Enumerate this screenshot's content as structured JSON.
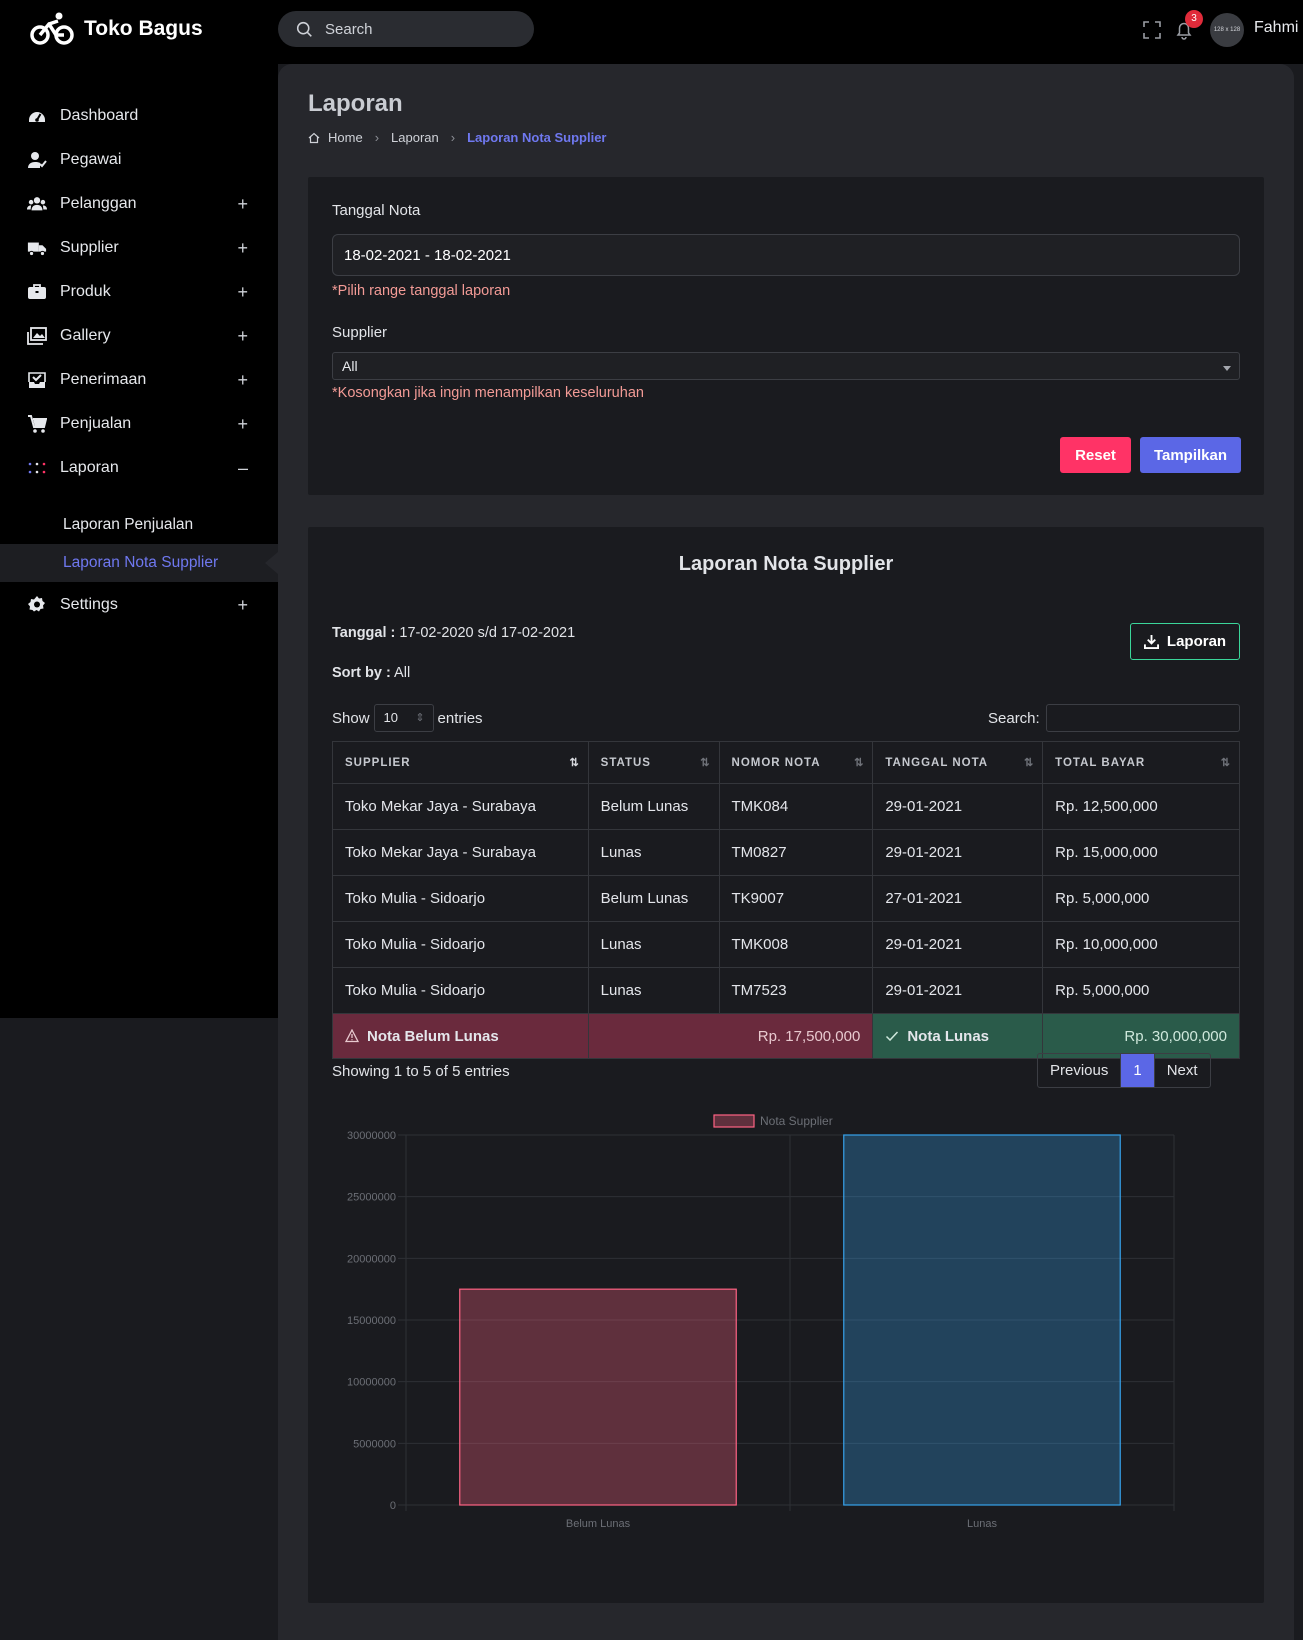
{
  "header": {
    "app_name": "Toko Bagus",
    "search_placeholder": "Search",
    "notification_count": "3",
    "avatar_text": "128 x 128",
    "username": "Fahmi"
  },
  "sidebar": {
    "items": [
      {
        "label": "Dashboard",
        "icon": "dashboard-icon"
      },
      {
        "label": "Pegawai",
        "icon": "user-check-icon"
      },
      {
        "label": "Pelanggan",
        "icon": "users-icon",
        "toggle": "+"
      },
      {
        "label": "Supplier",
        "icon": "truck-icon",
        "toggle": "+"
      },
      {
        "label": "Produk",
        "icon": "briefcase-icon",
        "toggle": "+"
      },
      {
        "label": "Gallery",
        "icon": "images-icon",
        "toggle": "+"
      },
      {
        "label": "Penerimaan",
        "icon": "inbox-check-icon",
        "toggle": "+"
      },
      {
        "label": "Penjualan",
        "icon": "cart-icon",
        "toggle": "+"
      },
      {
        "label": "Laporan",
        "icon": "grid-dots-icon",
        "toggle": "–"
      },
      {
        "label": "Settings",
        "icon": "gear-icon",
        "toggle": "+"
      }
    ],
    "laporan_children": [
      "Laporan Penjualan",
      "Laporan Nota Supplier"
    ]
  },
  "page": {
    "title": "Laporan",
    "breadcrumb": [
      "Home",
      "Laporan",
      "Laporan Nota Supplier"
    ]
  },
  "filter": {
    "date_label": "Tanggal Nota",
    "date_value": "18-02-2021 - 18-02-2021",
    "date_hint": "*Pilih range tanggal laporan",
    "supplier_label": "Supplier",
    "supplier_value": "All",
    "supplier_hint": "*Kosongkan jika ingin menampilkan keseluruhan",
    "reset_label": "Reset",
    "submit_label": "Tampilkan"
  },
  "report": {
    "title": "Laporan Nota Supplier",
    "tanggal_label": "Tanggal :",
    "tanggal_value": "17-02-2020 s/d 17-02-2021",
    "sort_label": "Sort by :",
    "sort_value": "All",
    "download_label": "Laporan",
    "show_label": "Show",
    "show_value": "10",
    "entries_label": "entries",
    "search_label": "Search:",
    "columns": [
      "SUPPLIER",
      "STATUS",
      "NOMOR NOTA",
      "TANGGAL NOTA",
      "TOTAL BAYAR"
    ],
    "rows": [
      [
        "Toko Mekar Jaya - Surabaya",
        "Belum Lunas",
        "TMK084",
        "29-01-2021",
        "Rp. 12,500,000"
      ],
      [
        "Toko Mekar Jaya - Surabaya",
        "Lunas",
        "TM0827",
        "29-01-2021",
        "Rp. 15,000,000"
      ],
      [
        "Toko Mulia - Sidoarjo",
        "Belum Lunas",
        "TK9007",
        "27-01-2021",
        "Rp. 5,000,000"
      ],
      [
        "Toko Mulia - Sidoarjo",
        "Lunas",
        "TMK008",
        "29-01-2021",
        "Rp. 10,000,000"
      ],
      [
        "Toko Mulia - Sidoarjo",
        "Lunas",
        "TM7523",
        "29-01-2021",
        "Rp. 5,000,000"
      ]
    ],
    "footer": {
      "unpaid_label": "Nota Belum Lunas",
      "unpaid_total": "Rp. 17,500,000",
      "paid_label": "Nota Lunas",
      "paid_total": "Rp. 30,000,000"
    },
    "showing_text": "Showing 1 to 5 of 5 entries",
    "pager": {
      "prev": "Previous",
      "page": "1",
      "next": "Next"
    }
  },
  "colors": {
    "accent": "#5b67e6",
    "reset": "#ff3366",
    "unpaid": "#6a2a3d",
    "paid": "#2a5b4a"
  },
  "chart_data": {
    "type": "bar",
    "categories": [
      "Belum Lunas",
      "Lunas"
    ],
    "series": [
      {
        "name": "Nota Supplier",
        "values": [
          17500000,
          30000000
        ]
      }
    ],
    "bar_fill": [
      "rgba(255,99,132,0.3)",
      "rgba(54,162,235,0.3)"
    ],
    "bar_border": [
      "#ff6384",
      "#36a2eb"
    ],
    "ylim": [
      0,
      30000000
    ],
    "yticks": [
      0,
      5000000,
      10000000,
      15000000,
      20000000,
      25000000,
      30000000
    ],
    "grid": true,
    "legend": "top"
  }
}
